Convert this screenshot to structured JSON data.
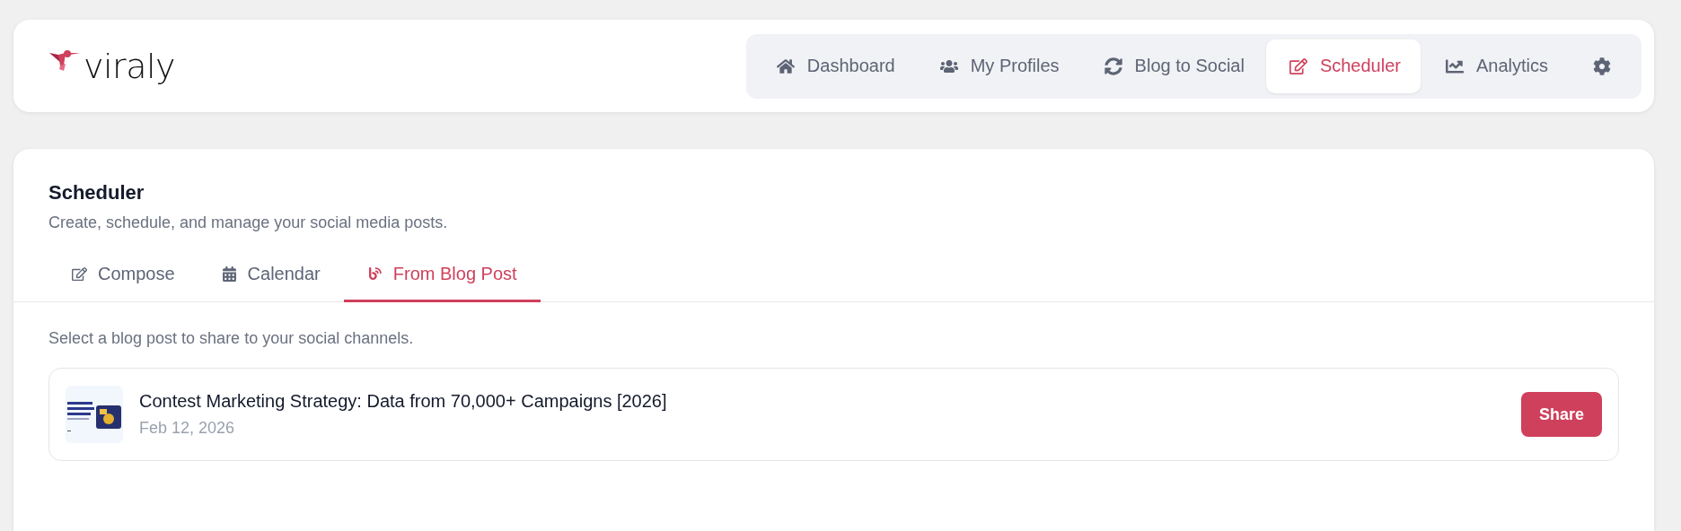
{
  "header": {
    "logo_text": "viraly",
    "nav": [
      {
        "label": "Dashboard",
        "selected": false
      },
      {
        "label": "My Profiles",
        "selected": false
      },
      {
        "label": "Blog to Social",
        "selected": false
      },
      {
        "label": "Scheduler",
        "selected": true
      },
      {
        "label": "Analytics",
        "selected": false
      }
    ]
  },
  "page": {
    "title": "Scheduler",
    "subtitle": "Create, schedule, and manage your social media posts.",
    "tabs": [
      {
        "label": "Compose",
        "selected": false
      },
      {
        "label": "Calendar",
        "selected": false
      },
      {
        "label": "From Blog Post",
        "selected": true
      }
    ],
    "intro": "Select a blog post to share to your social channels.",
    "posts": [
      {
        "title": "Contest Marketing Strategy: Data from 70,000+ Campaigns [2026]",
        "date": "Feb 12, 2026",
        "action": "Share"
      }
    ]
  }
}
